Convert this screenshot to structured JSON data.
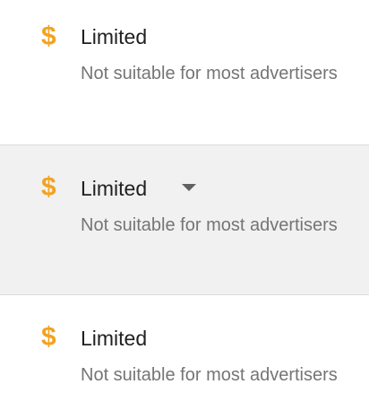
{
  "items": [
    {
      "icon": "dollar-sign-icon",
      "symbol": "$",
      "title": "Limited",
      "subtitle": "Not suitable for most advertisers",
      "selected": false
    },
    {
      "icon": "dollar-sign-icon",
      "symbol": "$",
      "title": "Limited",
      "subtitle": "Not suitable for most advertisers",
      "selected": true,
      "has_dropdown": true,
      "dropdown_icon": "caret-down-icon"
    },
    {
      "icon": "dollar-sign-icon",
      "symbol": "$",
      "title": "Limited",
      "subtitle": "Not suitable for most advertisers",
      "selected": false
    }
  ],
  "colors": {
    "icon": "#f2a320",
    "title": "#212121",
    "subtitle": "#757575",
    "selected_background": "#f1f1f1"
  }
}
